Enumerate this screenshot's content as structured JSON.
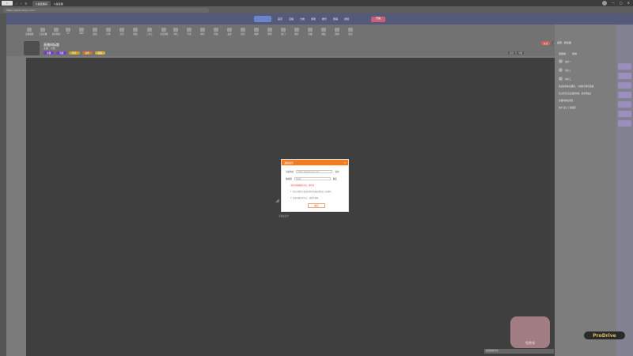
{
  "browser": {
    "tabs": [
      {
        "label": "斗鱼直播间"
      },
      {
        "label": "斗鱼直播"
      }
    ],
    "url": "https://www.douyu.com/",
    "nav_back": "‹",
    "nav_forward": "›",
    "nav_refresh": "↻",
    "window_controls": [
      "—",
      "▢",
      "✕"
    ]
  },
  "site": {
    "nav_items": [
      "首页",
      "直播",
      "分类",
      "游戏",
      "娱乐",
      "赛事",
      "视频"
    ],
    "nav_button": "开播",
    "categories": [
      "英雄联盟",
      "王者荣耀",
      "和平精英",
      "CF",
      "DNF",
      "颜值",
      "户外",
      "音乐",
      "舞蹈",
      "二次元",
      "主机游戏",
      "单机",
      "手游",
      "体育",
      "科技",
      "美食",
      "综合",
      "棋牌",
      "网游",
      "热门",
      "推荐",
      "直播",
      "视频",
      "赛事",
      "更多"
    ]
  },
  "streamer": {
    "title": "直播间标题",
    "sub": "主播 · 分区",
    "badges": [
      {
        "label": "主播",
        "color": "#7a3fc9"
      },
      {
        "label": "等级",
        "color": "#7a3fc9"
      },
      {
        "label": "粉丝",
        "color": "#c9a020"
      },
      {
        "label": "勋章",
        "color": "#d47030"
      },
      {
        "label": "贵族",
        "color": "#d4b030"
      }
    ],
    "header_buttons": [
      {
        "label": "关注",
        "color": "#c9605a"
      },
      {
        "label": "订阅",
        "color": "#666"
      }
    ]
  },
  "player": {
    "toolbar": [
      "画质",
      "举报"
    ],
    "hint": "直播加载中",
    "spinner_glyph": "◢",
    "gift_label": "免费领",
    "status": "视频播放状态"
  },
  "sidebar": {
    "head": "贵宾 · 粉丝团",
    "tabs": [
      "贡献榜",
      "周榜"
    ],
    "ranks": [
      {
        "name": "用户一"
      },
      {
        "name": "用户二"
      },
      {
        "name": "用户三"
      }
    ],
    "chat": [
      "欢迎来到本直播间，斗鱼倡导绿色直播",
      "禁止任何违法违规内容，请文明发言",
      "直播间系统消息",
      "用户 进入了直播间"
    ]
  },
  "watermark": "ProDrive",
  "dialog": {
    "title": "温馨提示",
    "close": "✕",
    "row1_label": "当前地址",
    "row1_value": "https://www.douyu.com",
    "row1_action": "复制",
    "row2_label": "播放器",
    "row2_value": "请选择",
    "row2_action": "确定",
    "error": "当前浏览器版本过低，请升级",
    "notes": [
      "1. 请尝试刷新页面或更换浏览器后重新进入直播间。",
      "2. 如果问题仍然存在，请联系客服。"
    ],
    "ok": "确定"
  }
}
